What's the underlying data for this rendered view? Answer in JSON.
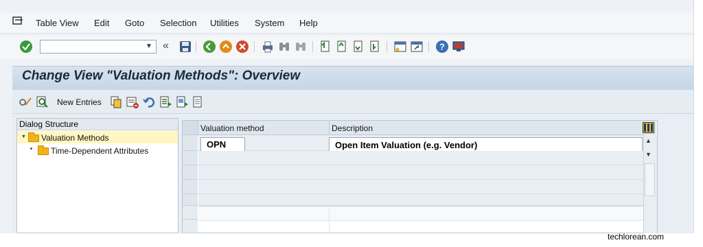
{
  "menu": {
    "items": [
      {
        "label": "Table View"
      },
      {
        "label": "Edit"
      },
      {
        "label": "Goto"
      },
      {
        "label": "Selection"
      },
      {
        "label": "Utilities"
      },
      {
        "label": "System"
      },
      {
        "label": "Help"
      }
    ]
  },
  "toolbar": {
    "command_value": "",
    "icons": [
      "enter-check-icon",
      "command-field",
      "back-arrows-icon",
      "save-icon",
      "back-icon",
      "exit-icon",
      "cancel-icon",
      "print-icon",
      "find-icon",
      "find-next-icon",
      "first-page-icon",
      "previous-page-icon",
      "next-page-icon",
      "last-page-icon",
      "create-session-icon",
      "shortcut-icon",
      "help-icon",
      "customize-layout-icon"
    ]
  },
  "title": "Change View \"Valuation Methods\": Overview",
  "app_toolbar": {
    "new_entries": "New Entries",
    "icons": [
      "display-change-icon",
      "find-icon",
      "copy-icon",
      "delete-icon",
      "undo-icon",
      "select-all-icon",
      "select-block-icon",
      "deselect-all-icon"
    ]
  },
  "dialog_structure": {
    "heading": "Dialog Structure",
    "nodes": [
      {
        "label": "Valuation Methods",
        "selected": true,
        "expanded": true
      },
      {
        "label": "Time-Dependent Attributes",
        "selected": false
      }
    ]
  },
  "table": {
    "columns": [
      "Valuation method",
      "Description"
    ],
    "rows": [
      {
        "valuation_method": "OPN",
        "description": "Open Item Valuation (e.g. Vendor)"
      }
    ]
  },
  "watermark": "techlorean.com",
  "colors": {
    "title_bar": "#c6d6e4",
    "selection": "#fff6c2",
    "folder": "#f4b21a"
  }
}
